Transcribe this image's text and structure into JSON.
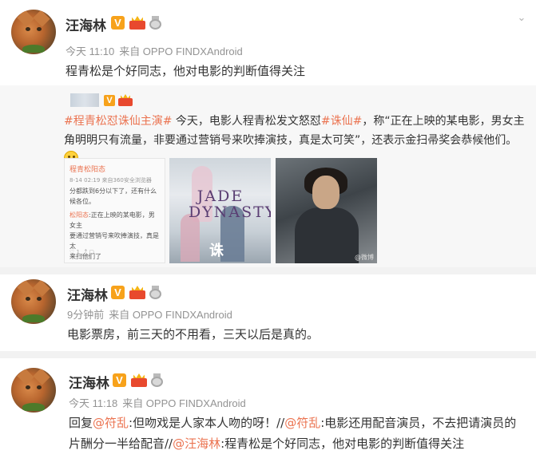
{
  "posts": [
    {
      "user": "汪海林",
      "time": "今天 11:10",
      "source": "来自 OPPO FINDXAndroid",
      "text": "程青松是个好同志，他对电影的判断值得关注"
    },
    {
      "user": "汪海林",
      "time": "9分钟前",
      "source": "来自 OPPO FINDXAndroid",
      "text": "电影票房，前三天的不用看，三天以后是真的。"
    },
    {
      "user": "汪海林",
      "time": "今天 11:18",
      "source": "来自 OPPO FINDXAndroid",
      "reply_prefix": "回复",
      "mention1": "@符乱",
      "part1": ":但吻戏是人家本人吻的呀！//",
      "mention2": "@符乱",
      "part2": ":电影还用配音演员，不去把请演员的片酬分一半给配音//",
      "mention3": "@汪海林",
      "part3": ":程青松是个好同志，他对电影的判断值得关注"
    }
  ],
  "badges": {
    "v": "V"
  },
  "repost": {
    "tag1": "#程青松怼诛仙主演#",
    "text1": " 今天，电影人程青松发文怒怼",
    "tag2": "#诛仙#",
    "text2": "，称“正在上映的某电影，男女主角明明只有流量，非要通过营销号来吹捧演技，真是太可笑”，还表示金扫帚奖会恭候他们。",
    "thumb1": {
      "name": "程青松阳态",
      "meta": "8-14 02:19  来自360安全浏览器",
      "line1": "分都跌到6分以下了，还有什么",
      "line2": "候各位。",
      "author": "松阳态",
      "line3": ":正在上映的某电影，男女主",
      "line4": "要通过营销号来吹捧演技，真是太",
      "line5": "来扫他们了",
      "actions": "♡ 1  ⤴  ▢"
    },
    "thumb2": {
      "title": "JADE DYNASTY",
      "cal": "诛"
    },
    "thumb3": {
      "wm": "@微博"
    }
  },
  "colors": {
    "accent": "#eb7350",
    "vbadge": "#f7a21b"
  }
}
